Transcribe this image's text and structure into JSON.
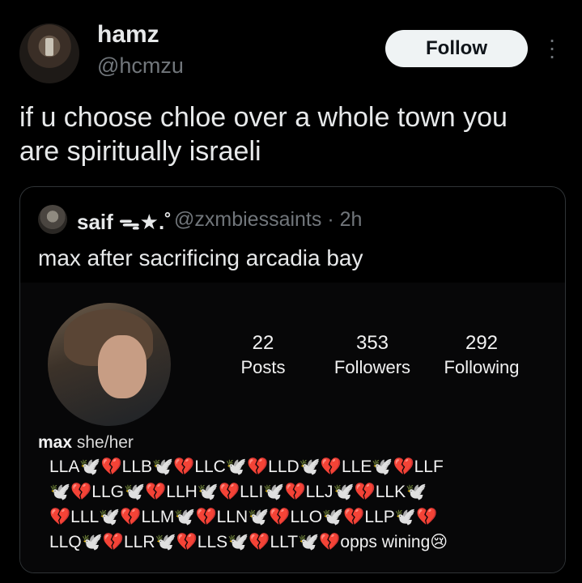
{
  "post": {
    "author": {
      "display_name": "hamz",
      "handle": "@hcmzu"
    },
    "follow_label": "Follow",
    "more_icon": "more-vertical-icon",
    "text_lines": [
      "if u choose chloe over a whole town you",
      "are spiritually israeli"
    ]
  },
  "quote": {
    "author": {
      "display_name": "saif ᯓ★.˚",
      "handle_time": "@zxmbiessaints · 2h"
    },
    "text": "max after sacrificing arcadia bay",
    "screenshot": {
      "stats": [
        {
          "value": "22",
          "label": "Posts"
        },
        {
          "value": "353",
          "label": "Followers"
        },
        {
          "value": "292",
          "label": "Following"
        }
      ],
      "bio": {
        "name": "max",
        "pronouns": "she/her",
        "lines": [
          "LLA🕊️💔LLB🕊️💔LLC🕊️💔LLD🕊️💔LLE🕊️💔LLF",
          "🕊️💔LLG🕊️💔LLH🕊️💔LLI🕊️💔LLJ🕊️💔LLK🕊️",
          "💔LLL🕊️💔LLM🕊️💔LLN🕊️💔LLO🕊️💔LLP🕊️💔",
          "LLQ🕊️💔LLR🕊️💔LLS🕊️💔LLT🕊️💔opps wining😢"
        ]
      }
    }
  }
}
